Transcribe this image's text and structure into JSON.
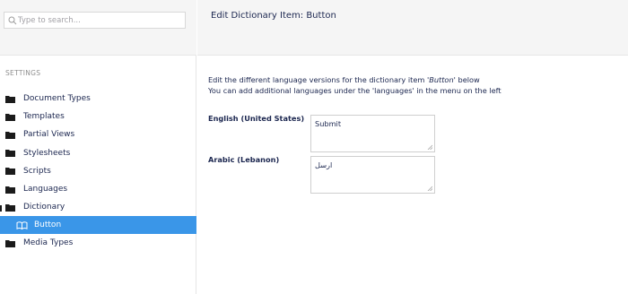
{
  "search": {
    "placeholder": "Type to search..."
  },
  "sidebar": {
    "section_title": "SETTINGS",
    "items": [
      {
        "label": "Document Types"
      },
      {
        "label": "Templates"
      },
      {
        "label": "Partial Views"
      },
      {
        "label": "Stylesheets"
      },
      {
        "label": "Scripts"
      },
      {
        "label": "Languages"
      },
      {
        "label": "Dictionary"
      },
      {
        "label": "Button"
      },
      {
        "label": "Media Types"
      }
    ]
  },
  "main": {
    "title": "Edit Dictionary Item: Button",
    "intro_line1_prefix": "Edit the different language versions for the dictionary item '",
    "intro_item_name": "Button",
    "intro_line1_suffix": "' below",
    "intro_line2": "You can add additional languages under the 'languages' in the menu on the left",
    "languages": [
      {
        "label": "English (United States)",
        "value": "Submit"
      },
      {
        "label": "Arabic (Lebanon)",
        "value": "ارسل"
      }
    ]
  },
  "colors": {
    "accent": "#3a96e8",
    "text": "#1b264f",
    "header_bg": "#f5f5f5"
  }
}
